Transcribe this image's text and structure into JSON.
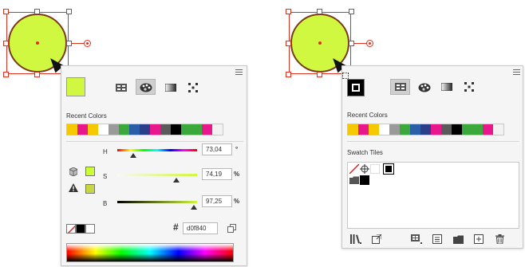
{
  "left_panel": {
    "recent_colors_label": "Recent Colors",
    "recent_colors": [
      "#f5c800",
      "#e8178c",
      "#f5c800",
      "#ffffff",
      "#9a9a9a",
      "#3aa83a",
      "#2a5fa8",
      "#2a3e8c",
      "#e8178c",
      "#5a5a5a",
      "#000000",
      "#3aa83a",
      "#3aa83a",
      "#e8178c",
      "#f2f2f2"
    ],
    "current_fill": "#d0f840",
    "sliders": [
      {
        "label": "H",
        "value": "73,04",
        "unit": "°",
        "fraction": 0.2
      },
      {
        "label": "S",
        "value": "74,19",
        "unit": "%",
        "fraction": 0.74
      },
      {
        "label": "B",
        "value": "97,25",
        "unit": "%",
        "fraction": 0.97
      }
    ],
    "hex_symbol": "#",
    "hex_value": "d0f840"
  },
  "right_panel": {
    "recent_colors_label": "Recent Colors",
    "recent_colors": [
      "#f5c800",
      "#e8178c",
      "#f5c800",
      "#ffffff",
      "#9a9a9a",
      "#3aa83a",
      "#2a5fa8",
      "#2a3e8c",
      "#e8178c",
      "#5a5a5a",
      "#000000",
      "#3aa83a",
      "#3aa83a",
      "#e8178c",
      "#f2f2f2"
    ],
    "swatch_tiles_label": "Swatch Tiles"
  },
  "colors": {
    "accent_selection": "#e03020",
    "object_fill": "#d0f840",
    "object_stroke": "#7a3a1a"
  }
}
